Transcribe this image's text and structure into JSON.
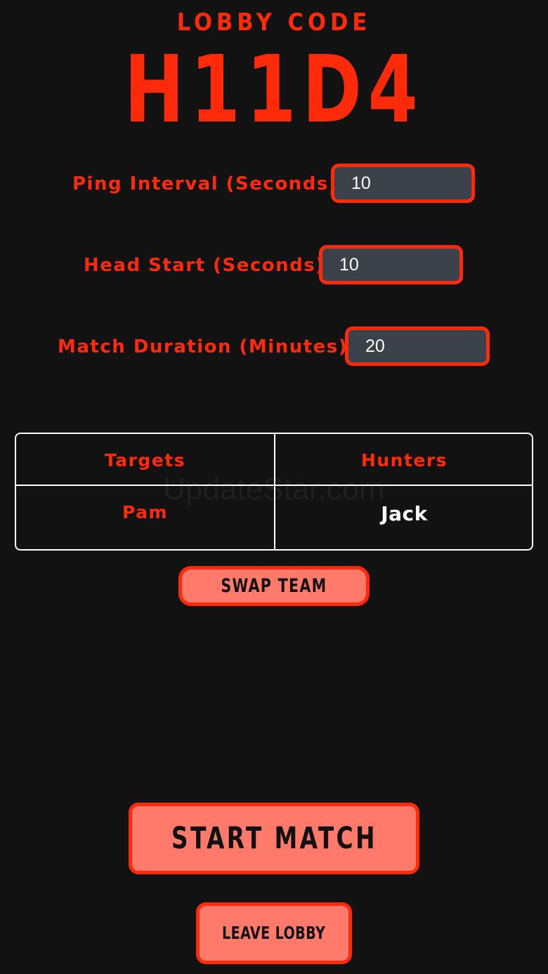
{
  "header": {
    "label": "LOBBY CODE",
    "code": "H11D4"
  },
  "settings": {
    "ping_interval": {
      "label": "Ping Interval (Seconds)",
      "value": "10"
    },
    "head_start": {
      "label": "Head Start (Seconds)",
      "value": "10"
    },
    "match_duration": {
      "label": "Match Duration (Minutes)",
      "value": "20"
    }
  },
  "teams": {
    "targets_header": "Targets",
    "hunters_header": "Hunters",
    "targets_player": "Pam",
    "hunters_player": "Jack"
  },
  "watermark": "UpdateStar.com",
  "buttons": {
    "swap_team": "SWAP TEAM",
    "start_match": "START MATCH",
    "leave_lobby": "LEAVE LOBBY"
  },
  "colors": {
    "accent": "#ff2a0a",
    "button_fill": "#ff7a6a",
    "input_fill": "#3c4249",
    "background": "#121212"
  }
}
